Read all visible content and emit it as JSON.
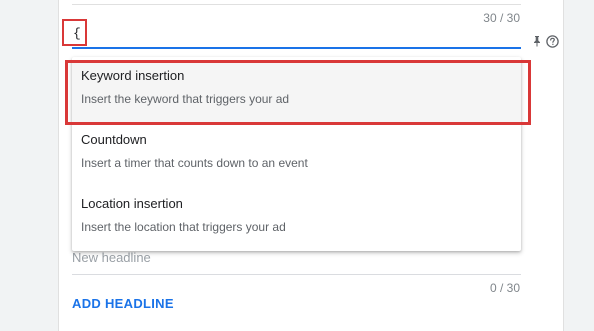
{
  "headline_field": {
    "value": "{",
    "char_count": "30 / 30"
  },
  "insertion_menu": {
    "items": [
      {
        "title": "Keyword insertion",
        "description": "Insert the keyword that triggers your ad"
      },
      {
        "title": "Countdown",
        "description": "Insert a timer that counts down to an event"
      },
      {
        "title": "Location insertion",
        "description": "Insert the location that triggers your ad"
      }
    ]
  },
  "new_headline": {
    "placeholder": "New headline",
    "char_count": "0 / 30"
  },
  "add_headline_label": "ADD HEADLINE",
  "icons": {
    "pin": "pin-icon",
    "help": "help-circle-icon"
  },
  "colors": {
    "accent_blue": "#1a73e8",
    "annotation_red": "#d93838"
  }
}
